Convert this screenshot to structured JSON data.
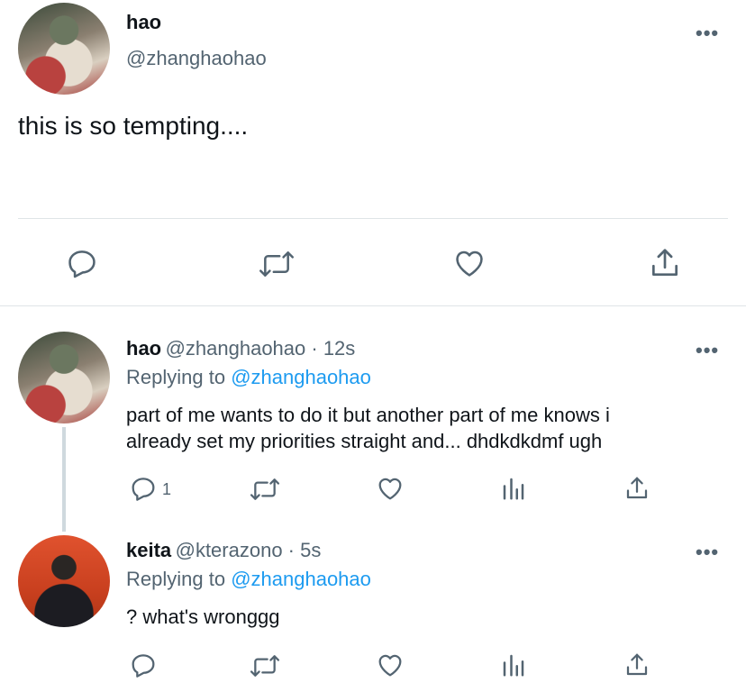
{
  "main_tweet": {
    "name": "hao",
    "handle": "@zhanghaohao",
    "text": "this is so tempting....",
    "more": "•••"
  },
  "replies": [
    {
      "name": "hao",
      "handle_time": "@zhanghaohao · 12s",
      "replying_label": "Replying to",
      "replying_handle": "@zhanghaohao",
      "text_line1": "part of me wants to do it but another part of me knows i",
      "text_line2": "already set my priorities straight and... dhdkdkdmf ugh",
      "reply_count": "1",
      "more": "•••"
    },
    {
      "name": "keita",
      "handle_time": "@kterazono · 5s",
      "replying_label": "Replying to",
      "replying_handle": "@zhanghaohao",
      "text_line1": "? what's wronggg",
      "more": "•••"
    }
  ],
  "icons": [
    "reply-icon",
    "retweet-icon",
    "like-icon",
    "share-icon",
    "analytics-icon",
    "more-icon"
  ],
  "colors": {
    "link_blue": "#1d9bf0",
    "secondary_gray": "#536471",
    "divider": "#eff3f4",
    "thread_line": "#cfd9de"
  }
}
